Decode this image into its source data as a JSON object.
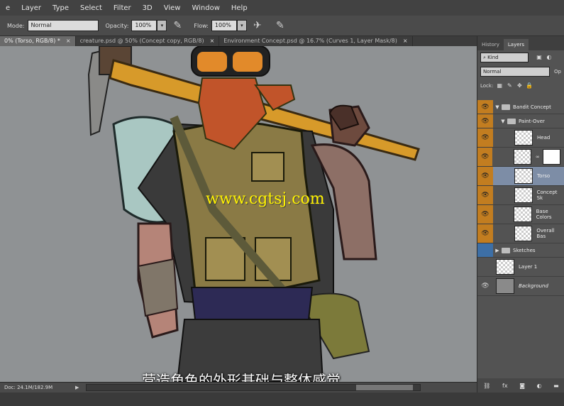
{
  "menu": [
    "e",
    "Layer",
    "Type",
    "Select",
    "Filter",
    "3D",
    "View",
    "Window",
    "Help"
  ],
  "options": {
    "mode_label": "Mode:",
    "mode_value": "Normal",
    "opacity_label": "Opacity:",
    "opacity_value": "100%",
    "flow_label": "Flow:",
    "flow_value": "100%"
  },
  "tabs": [
    {
      "label": "0% (Torso, RGB/8) *",
      "active": true
    },
    {
      "label": "creature.psd @ 50% (Concept copy, RGB/8)",
      "active": false
    },
    {
      "label": "Environment Concept.psd @ 16.7% (Curves 1, Layer Mask/8)",
      "active": false
    }
  ],
  "tab_close": "×",
  "canvas": {
    "watermark": "www.cgtsj.com",
    "subtitle": "营造角色的外形基础与整体感觉"
  },
  "status": {
    "doc": "Doc: 24.1M/182.9M",
    "arrow": "▶"
  },
  "panel": {
    "tabs": [
      "History",
      "Layers"
    ],
    "kind": "Kind",
    "blend_mode": "Normal",
    "opacity_short": "Op",
    "lock_label": "Lock:",
    "layers": [
      {
        "name": "Bandit Concept",
        "type": "group",
        "eye": "orange",
        "open": true
      },
      {
        "name": "Paint-Over",
        "type": "group",
        "eye": "orange",
        "open": true
      },
      {
        "name": "Head",
        "type": "layer",
        "eye": "orange"
      },
      {
        "name": "",
        "type": "mask",
        "eye": "orange"
      },
      {
        "name": "Torso",
        "type": "layer",
        "eye": "orange",
        "selected": true
      },
      {
        "name": "Concept Sk",
        "type": "layer",
        "eye": "orange"
      },
      {
        "name": "Base Colors",
        "type": "layer",
        "eye": "orange"
      },
      {
        "name": "Overall Bas",
        "type": "layer",
        "eye": "orange"
      },
      {
        "name": "Sketches",
        "type": "group",
        "eye": "blue",
        "open": false
      },
      {
        "name": "Layer 1",
        "type": "layer",
        "eye": "gray"
      },
      {
        "name": "Background",
        "type": "background",
        "eye": "gray"
      }
    ],
    "footer_icons": [
      "link-icon",
      "fx-icon",
      "mask-icon",
      "adjustment-icon",
      "folder-icon"
    ]
  }
}
